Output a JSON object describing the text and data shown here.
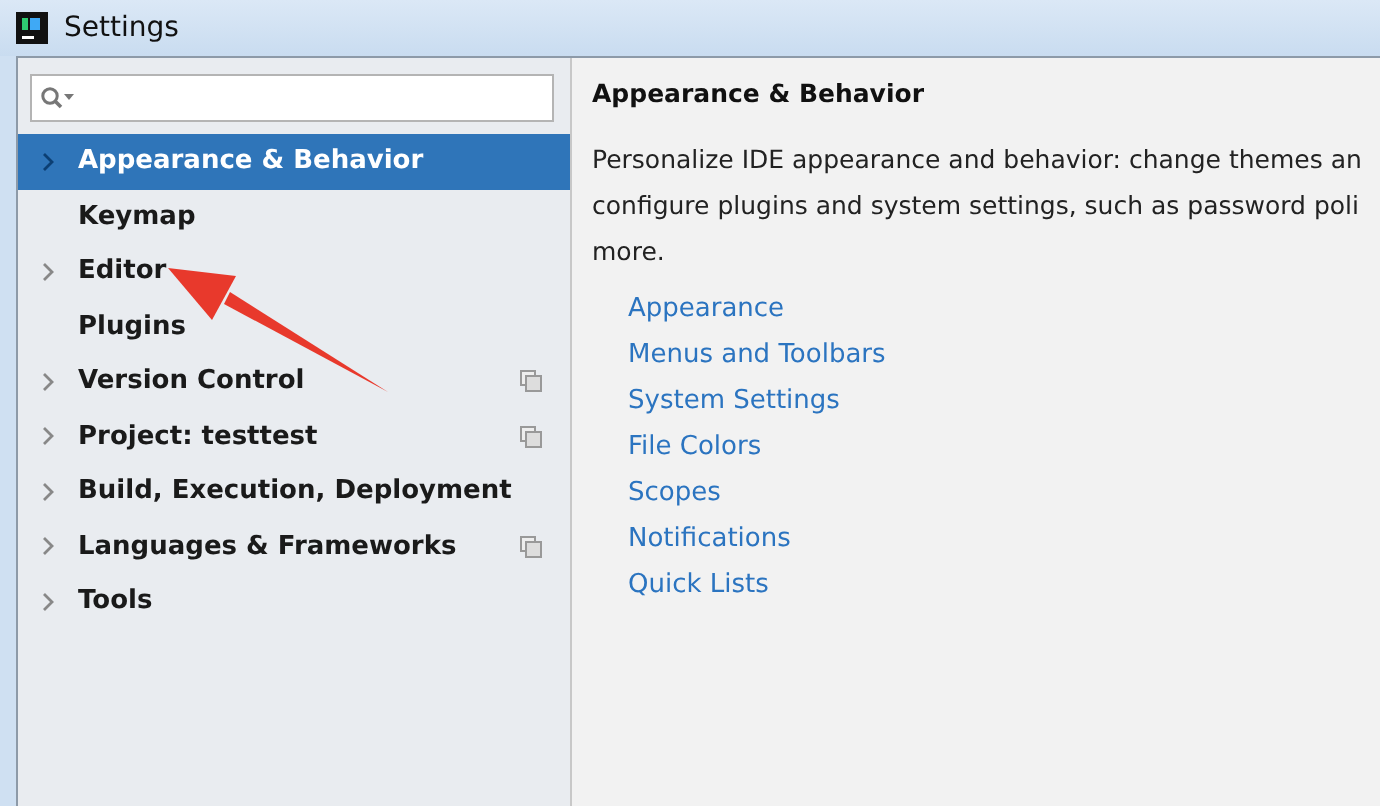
{
  "window": {
    "title": "Settings"
  },
  "sidebar": {
    "items": [
      {
        "label": "Appearance & Behavior",
        "expandable": true,
        "selected": true,
        "project_level": false
      },
      {
        "label": "Keymap",
        "expandable": false,
        "selected": false,
        "project_level": false
      },
      {
        "label": "Editor",
        "expandable": true,
        "selected": false,
        "project_level": false
      },
      {
        "label": "Plugins",
        "expandable": false,
        "selected": false,
        "project_level": false
      },
      {
        "label": "Version Control",
        "expandable": true,
        "selected": false,
        "project_level": true
      },
      {
        "label": "Project: testtest",
        "expandable": true,
        "selected": false,
        "project_level": true
      },
      {
        "label": "Build, Execution, Deployment",
        "expandable": true,
        "selected": false,
        "project_level": false
      },
      {
        "label": "Languages & Frameworks",
        "expandable": true,
        "selected": false,
        "project_level": true
      },
      {
        "label": "Tools",
        "expandable": true,
        "selected": false,
        "project_level": false
      }
    ]
  },
  "content": {
    "heading": "Appearance & Behavior",
    "description_lines": [
      "Personalize IDE appearance and behavior: change themes an",
      "configure plugins and system settings, such as password poli",
      "more."
    ],
    "links": [
      "Appearance",
      "Menus and Toolbars",
      "System Settings",
      "File Colors",
      "Scopes",
      "Notifications",
      "Quick Lists"
    ]
  }
}
